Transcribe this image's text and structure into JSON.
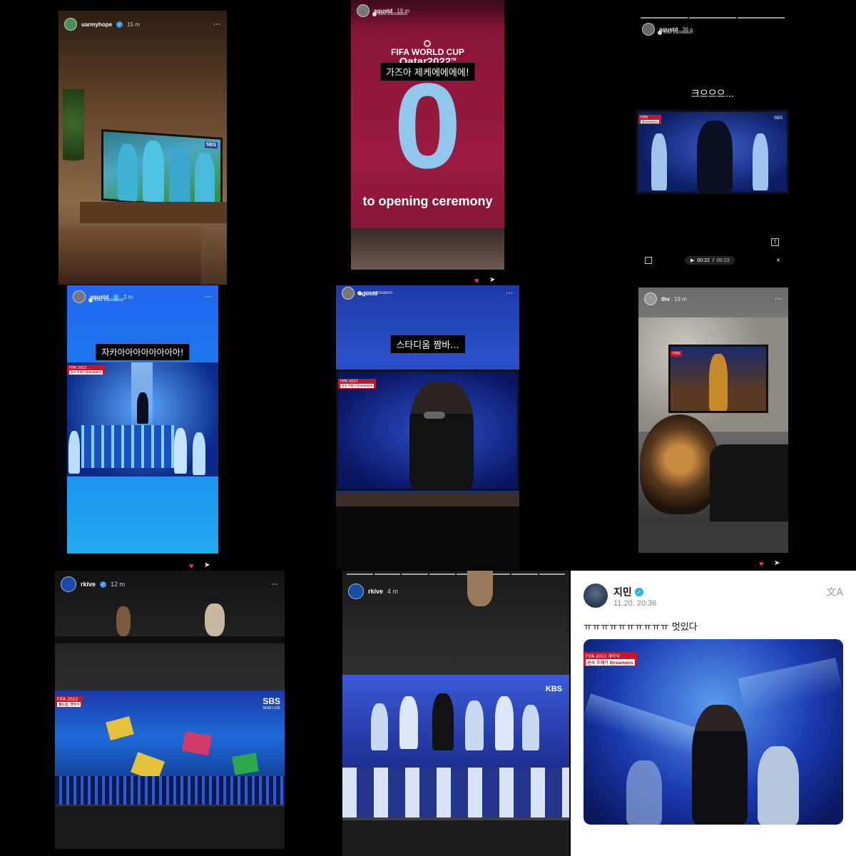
{
  "panels": {
    "p1": {
      "username": "uarmyhope",
      "time": "15 m",
      "tv_logo": "SBS"
    },
    "p2": {
      "username": "agustd",
      "time": "19 m",
      "see_translation": "See translation",
      "event_line1": "FIFA WORLD CUP",
      "event_line2": "Qatar2022",
      "tm": "TM",
      "caption": "가즈아 제케에에에에!",
      "count": "0",
      "subtitle": "to opening ceremony"
    },
    "p3": {
      "username": "agustd",
      "time": "36 s",
      "see_translation": "See translation",
      "caption": "크으으으...",
      "video_time": "00:22",
      "video_total": "00:23",
      "tv_logo": "SBS"
    },
    "p4": {
      "username": "agustd",
      "time": "2 m",
      "see_translation": "See translation",
      "caption": "자카아아아아아아아아!",
      "banner_title": "FIFA 2022",
      "banner_sub": "공식 주제가 Dreamers"
    },
    "p5": {
      "username": "agustd",
      "see_translation": "See translation",
      "caption": "스타디움 짬바...",
      "banner_title": "FIFA 2022",
      "banner_sub": "공식 주제가 Dreamers"
    },
    "p6": {
      "username": "thv",
      "time": "19 m"
    },
    "p7": {
      "username": "rkive",
      "time": "12 m",
      "banner_title": "FIFA 2022",
      "banner_sub": "월드컵 개막식",
      "tv_logo": "SBS",
      "tv_sub": "NOW LIVE"
    },
    "p8": {
      "username": "rkive",
      "time": "4 m",
      "tv_logo": "KBS"
    },
    "p9": {
      "name": "지민",
      "timestamp": "11.20. 20:36",
      "text": "ㅠㅠㅠㅠㅠㅠㅠㅠㅠㅠ 멋있다",
      "banner_title": "FIFA 2022 개막식",
      "banner_sub": "공식 주제가 Dreamers",
      "translate_icon": "translate-icon"
    }
  },
  "colors": {
    "heart": "#ff2d55",
    "verified": "#3897f0",
    "qatar_maroon": "#8a1538"
  }
}
